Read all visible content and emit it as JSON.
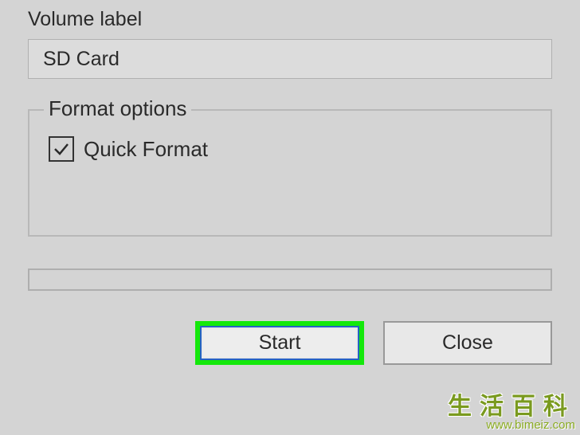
{
  "volume": {
    "label": "Volume label",
    "value": "SD Card"
  },
  "format_options": {
    "legend": "Format options",
    "quick_format": {
      "label": "Quick Format",
      "checked": true
    }
  },
  "buttons": {
    "start": "Start",
    "close": "Close"
  },
  "watermark": {
    "cn": "生活百科",
    "url": "www.bimeiz.com"
  }
}
